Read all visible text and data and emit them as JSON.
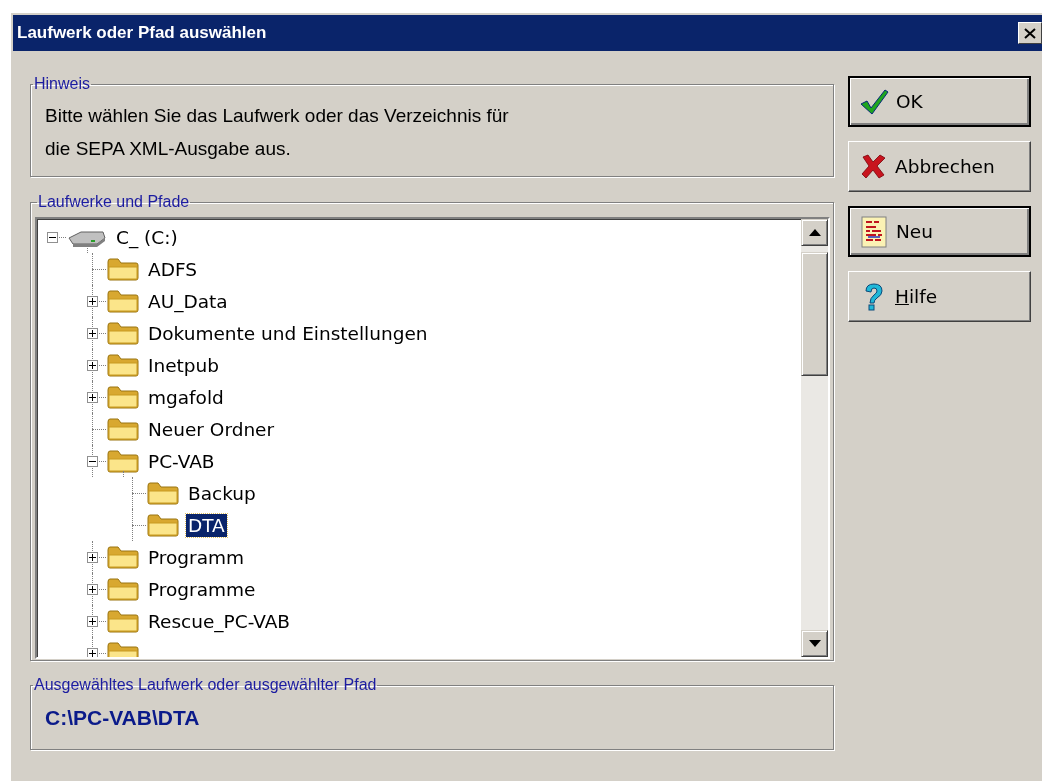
{
  "window": {
    "title": "Laufwerk oder Pfad auswählen"
  },
  "hint": {
    "legend": "Hinweis",
    "text": "Bitte wählen Sie das Laufwerk oder das Verzeichnis für\ndie SEPA XML-Ausgabe aus."
  },
  "tree": {
    "legend": "Laufwerke und Pfade",
    "items": [
      {
        "kind": "drive",
        "label": "C_ (C:)",
        "expanded": true,
        "selected": false,
        "children": [
          {
            "kind": "folder",
            "label": "ADFS",
            "selected": false
          },
          {
            "kind": "folder",
            "label": "AU_Data",
            "expanded": false,
            "selected": false
          },
          {
            "kind": "folder",
            "label": "Dokumente und Einstellungen",
            "expanded": false,
            "selected": false
          },
          {
            "kind": "folder",
            "label": "Inetpub",
            "expanded": false,
            "selected": false
          },
          {
            "kind": "folder",
            "label": "mgafold",
            "expanded": false,
            "selected": false
          },
          {
            "kind": "folder",
            "label": "Neuer Ordner",
            "selected": false
          },
          {
            "kind": "folder",
            "label": "PC-VAB",
            "expanded": true,
            "selected": false,
            "children": [
              {
                "kind": "folder",
                "label": "Backup",
                "selected": false
              },
              {
                "kind": "folder",
                "label": "DTA",
                "selected": true
              }
            ]
          },
          {
            "kind": "folder",
            "label": "Programm",
            "expanded": false,
            "selected": false
          },
          {
            "kind": "folder",
            "label": "Programme",
            "expanded": false,
            "selected": false
          },
          {
            "kind": "folder",
            "label": "Rescue_PC-VAB",
            "expanded": false,
            "selected": false
          },
          {
            "kind": "folder",
            "expanded": false
          }
        ]
      }
    ]
  },
  "selected_path": {
    "legend": "Ausgewähltes Laufwerk oder ausgewählter Pfad",
    "value": "C:\\PC-VAB\\DTA"
  },
  "buttons": [
    {
      "kind": "ok",
      "label": "OK",
      "default": true
    },
    {
      "kind": "cancel",
      "label": "Abbrechen",
      "default": false
    },
    {
      "kind": "new",
      "label": "Neu",
      "default": true
    },
    {
      "kind": "help",
      "label": "Hilfe",
      "default": false,
      "mnemonic_underlined": true
    }
  ]
}
